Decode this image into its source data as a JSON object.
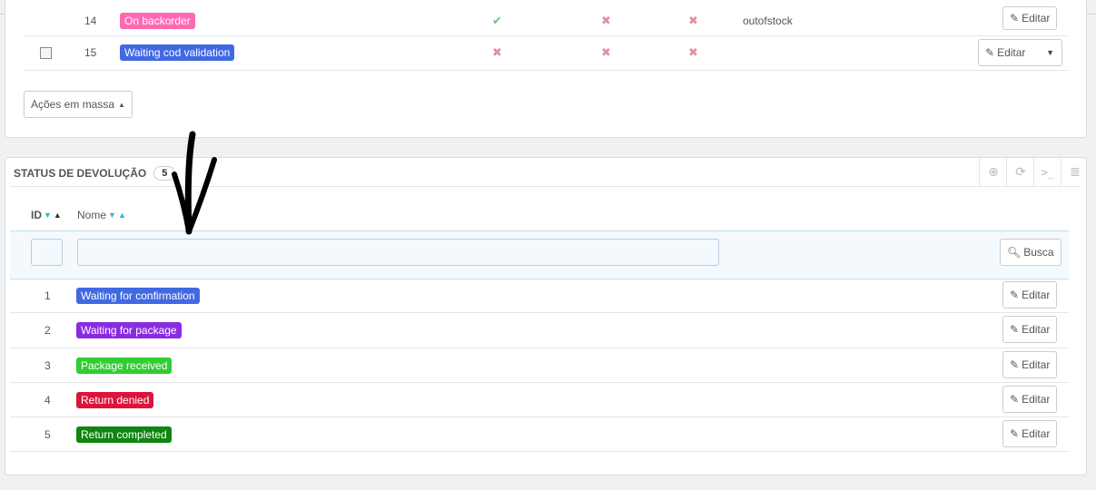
{
  "top_table": {
    "rows": [
      {
        "id": "14",
        "status": "On backorder",
        "color": "#ff69b4",
        "col1": "ok",
        "col2": "x",
        "col3": "x",
        "template": "outofstock",
        "edit_label": "Editar",
        "has_checkbox": false,
        "has_dropdown": false
      },
      {
        "id": "15",
        "status": "Waiting cod validation",
        "color": "#4169e1",
        "col1": "x",
        "col2": "x",
        "col3": "x",
        "template": "",
        "edit_label": "Editar",
        "has_checkbox": true,
        "has_dropdown": true
      }
    ],
    "bulk_actions_label": "Ações em massa"
  },
  "return_status": {
    "title": "STATUS DE DEVOLUÇÃO",
    "count": "5",
    "columns": {
      "id": "ID",
      "name": "Nome"
    },
    "search_label": "Busca",
    "rows": [
      {
        "id": "1",
        "name": "Waiting for confirmation",
        "color": "#4169e1",
        "edit_label": "Editar"
      },
      {
        "id": "2",
        "name": "Waiting for package",
        "color": "#8a2be2",
        "edit_label": "Editar"
      },
      {
        "id": "3",
        "name": "Package received",
        "color": "#32cd32",
        "edit_label": "Editar"
      },
      {
        "id": "4",
        "name": "Return denied",
        "color": "#dc143c",
        "edit_label": "Editar"
      },
      {
        "id": "5",
        "name": "Return completed",
        "color": "#108510",
        "edit_label": "Editar"
      }
    ],
    "toolbar_icons": [
      "add-icon",
      "refresh-icon",
      "sql-icon",
      "database-icon"
    ]
  }
}
